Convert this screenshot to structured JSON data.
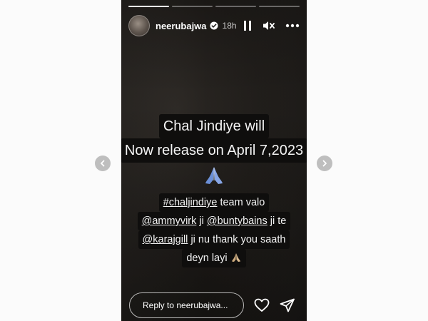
{
  "story": {
    "progress_segments": 4,
    "active_segment": 1,
    "header": {
      "username": "neerubajwa",
      "time": "18h",
      "icons": [
        "avatar",
        "verified-icon",
        "pause-icon",
        "mute-icon",
        "more-icon"
      ]
    },
    "text": {
      "line1": "Chal Jindiye will",
      "line2": "Now release on April 7,2023",
      "emoji": "🙏",
      "tag_line": "#chaljindiye team valo",
      "mention1": "@ammyvirk",
      "mention1_after": " ji ",
      "mention2": "@buntybains",
      "mention2_after": " ji te",
      "mention3": "@karajgill",
      "mention3_after": " ji nu thank you saath",
      "last_line": "deyn layi",
      "last_emoji": "🙏"
    },
    "reply_placeholder": "Reply to neerubajwa...",
    "colors": {
      "text_bg": "#0f0e0d",
      "story_bg": "#1f1c19"
    }
  }
}
